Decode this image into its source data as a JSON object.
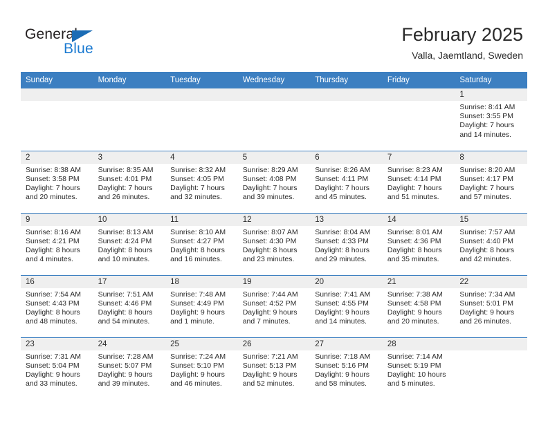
{
  "brand": {
    "name_top": "General",
    "name_bottom": "Blue",
    "triangle_color": "#1b6cb5",
    "blue_color": "#1b7ad1"
  },
  "header": {
    "title": "February 2025",
    "subtitle": "Valla, Jaemtland, Sweden"
  },
  "theme": {
    "header_blue": "#3c7fc1",
    "daynum_band": "#efefef",
    "text": "#2b2b2b"
  },
  "weekdays": [
    "Sunday",
    "Monday",
    "Tuesday",
    "Wednesday",
    "Thursday",
    "Friday",
    "Saturday"
  ],
  "labels": {
    "sunrise": "Sunrise:",
    "sunset": "Sunset:",
    "daylight": "Daylight:"
  },
  "weeks": [
    [
      {
        "day": "",
        "empty": true
      },
      {
        "day": "",
        "empty": true
      },
      {
        "day": "",
        "empty": true
      },
      {
        "day": "",
        "empty": true
      },
      {
        "day": "",
        "empty": true
      },
      {
        "day": "",
        "empty": true
      },
      {
        "day": "1",
        "sunrise": "Sunrise: 8:41 AM",
        "sunset": "Sunset: 3:55 PM",
        "daylight_1": "Daylight: 7 hours",
        "daylight_2": "and 14 minutes."
      }
    ],
    [
      {
        "day": "2",
        "sunrise": "Sunrise: 8:38 AM",
        "sunset": "Sunset: 3:58 PM",
        "daylight_1": "Daylight: 7 hours",
        "daylight_2": "and 20 minutes."
      },
      {
        "day": "3",
        "sunrise": "Sunrise: 8:35 AM",
        "sunset": "Sunset: 4:01 PM",
        "daylight_1": "Daylight: 7 hours",
        "daylight_2": "and 26 minutes."
      },
      {
        "day": "4",
        "sunrise": "Sunrise: 8:32 AM",
        "sunset": "Sunset: 4:05 PM",
        "daylight_1": "Daylight: 7 hours",
        "daylight_2": "and 32 minutes."
      },
      {
        "day": "5",
        "sunrise": "Sunrise: 8:29 AM",
        "sunset": "Sunset: 4:08 PM",
        "daylight_1": "Daylight: 7 hours",
        "daylight_2": "and 39 minutes."
      },
      {
        "day": "6",
        "sunrise": "Sunrise: 8:26 AM",
        "sunset": "Sunset: 4:11 PM",
        "daylight_1": "Daylight: 7 hours",
        "daylight_2": "and 45 minutes."
      },
      {
        "day": "7",
        "sunrise": "Sunrise: 8:23 AM",
        "sunset": "Sunset: 4:14 PM",
        "daylight_1": "Daylight: 7 hours",
        "daylight_2": "and 51 minutes."
      },
      {
        "day": "8",
        "sunrise": "Sunrise: 8:20 AM",
        "sunset": "Sunset: 4:17 PM",
        "daylight_1": "Daylight: 7 hours",
        "daylight_2": "and 57 minutes."
      }
    ],
    [
      {
        "day": "9",
        "sunrise": "Sunrise: 8:16 AM",
        "sunset": "Sunset: 4:21 PM",
        "daylight_1": "Daylight: 8 hours",
        "daylight_2": "and 4 minutes."
      },
      {
        "day": "10",
        "sunrise": "Sunrise: 8:13 AM",
        "sunset": "Sunset: 4:24 PM",
        "daylight_1": "Daylight: 8 hours",
        "daylight_2": "and 10 minutes."
      },
      {
        "day": "11",
        "sunrise": "Sunrise: 8:10 AM",
        "sunset": "Sunset: 4:27 PM",
        "daylight_1": "Daylight: 8 hours",
        "daylight_2": "and 16 minutes."
      },
      {
        "day": "12",
        "sunrise": "Sunrise: 8:07 AM",
        "sunset": "Sunset: 4:30 PM",
        "daylight_1": "Daylight: 8 hours",
        "daylight_2": "and 23 minutes."
      },
      {
        "day": "13",
        "sunrise": "Sunrise: 8:04 AM",
        "sunset": "Sunset: 4:33 PM",
        "daylight_1": "Daylight: 8 hours",
        "daylight_2": "and 29 minutes."
      },
      {
        "day": "14",
        "sunrise": "Sunrise: 8:01 AM",
        "sunset": "Sunset: 4:36 PM",
        "daylight_1": "Daylight: 8 hours",
        "daylight_2": "and 35 minutes."
      },
      {
        "day": "15",
        "sunrise": "Sunrise: 7:57 AM",
        "sunset": "Sunset: 4:40 PM",
        "daylight_1": "Daylight: 8 hours",
        "daylight_2": "and 42 minutes."
      }
    ],
    [
      {
        "day": "16",
        "sunrise": "Sunrise: 7:54 AM",
        "sunset": "Sunset: 4:43 PM",
        "daylight_1": "Daylight: 8 hours",
        "daylight_2": "and 48 minutes."
      },
      {
        "day": "17",
        "sunrise": "Sunrise: 7:51 AM",
        "sunset": "Sunset: 4:46 PM",
        "daylight_1": "Daylight: 8 hours",
        "daylight_2": "and 54 minutes."
      },
      {
        "day": "18",
        "sunrise": "Sunrise: 7:48 AM",
        "sunset": "Sunset: 4:49 PM",
        "daylight_1": "Daylight: 9 hours",
        "daylight_2": "and 1 minute."
      },
      {
        "day": "19",
        "sunrise": "Sunrise: 7:44 AM",
        "sunset": "Sunset: 4:52 PM",
        "daylight_1": "Daylight: 9 hours",
        "daylight_2": "and 7 minutes."
      },
      {
        "day": "20",
        "sunrise": "Sunrise: 7:41 AM",
        "sunset": "Sunset: 4:55 PM",
        "daylight_1": "Daylight: 9 hours",
        "daylight_2": "and 14 minutes."
      },
      {
        "day": "21",
        "sunrise": "Sunrise: 7:38 AM",
        "sunset": "Sunset: 4:58 PM",
        "daylight_1": "Daylight: 9 hours",
        "daylight_2": "and 20 minutes."
      },
      {
        "day": "22",
        "sunrise": "Sunrise: 7:34 AM",
        "sunset": "Sunset: 5:01 PM",
        "daylight_1": "Daylight: 9 hours",
        "daylight_2": "and 26 minutes."
      }
    ],
    [
      {
        "day": "23",
        "sunrise": "Sunrise: 7:31 AM",
        "sunset": "Sunset: 5:04 PM",
        "daylight_1": "Daylight: 9 hours",
        "daylight_2": "and 33 minutes."
      },
      {
        "day": "24",
        "sunrise": "Sunrise: 7:28 AM",
        "sunset": "Sunset: 5:07 PM",
        "daylight_1": "Daylight: 9 hours",
        "daylight_2": "and 39 minutes."
      },
      {
        "day": "25",
        "sunrise": "Sunrise: 7:24 AM",
        "sunset": "Sunset: 5:10 PM",
        "daylight_1": "Daylight: 9 hours",
        "daylight_2": "and 46 minutes."
      },
      {
        "day": "26",
        "sunrise": "Sunrise: 7:21 AM",
        "sunset": "Sunset: 5:13 PM",
        "daylight_1": "Daylight: 9 hours",
        "daylight_2": "and 52 minutes."
      },
      {
        "day": "27",
        "sunrise": "Sunrise: 7:18 AM",
        "sunset": "Sunset: 5:16 PM",
        "daylight_1": "Daylight: 9 hours",
        "daylight_2": "and 58 minutes."
      },
      {
        "day": "28",
        "sunrise": "Sunrise: 7:14 AM",
        "sunset": "Sunset: 5:19 PM",
        "daylight_1": "Daylight: 10 hours",
        "daylight_2": "and 5 minutes."
      },
      {
        "day": "",
        "empty": true
      }
    ]
  ]
}
